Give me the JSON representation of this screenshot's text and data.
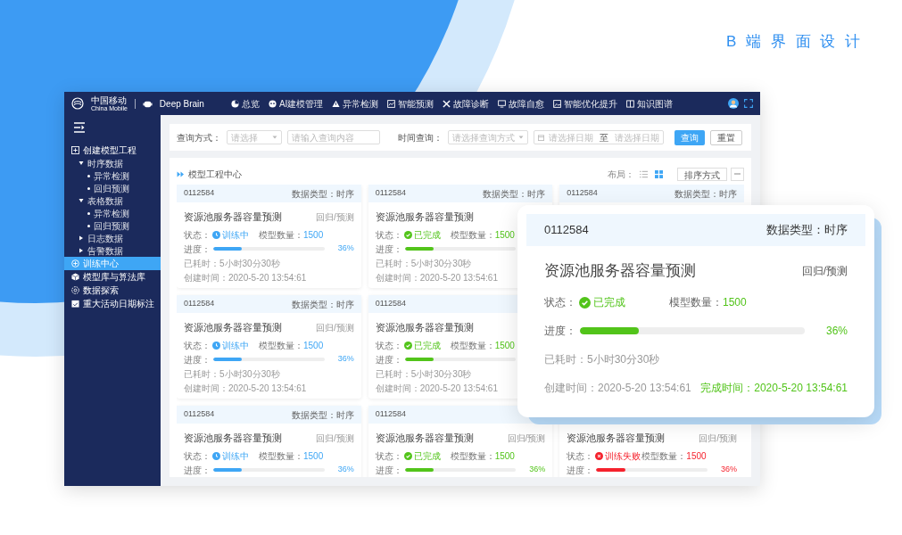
{
  "heading": "B 端 界 面 设 计",
  "header": {
    "brand": "中国移动",
    "brand_sub": "China Mobile",
    "product": "Deep Brain",
    "nav": [
      "总览",
      "AI建模管理",
      "异常检测",
      "智能预测",
      "故障诊断",
      "故障自愈",
      "智能优化提升",
      "知识图谱"
    ]
  },
  "sidebar": {
    "items": [
      {
        "label": "创建模型工程",
        "selected": false,
        "children": [
          {
            "label": "时序数据",
            "selected": false,
            "expanded": true,
            "children": [
              {
                "label": "异常检测",
                "selected": false
              },
              {
                "label": "回归预测",
                "selected": false
              }
            ]
          },
          {
            "label": "表格数据",
            "selected": false,
            "expanded": true,
            "children": [
              {
                "label": "异常检测",
                "selected": false
              },
              {
                "label": "回归预测",
                "selected": false
              }
            ]
          },
          {
            "label": "日志数据",
            "selected": false,
            "expanded": false
          },
          {
            "label": "告警数据",
            "selected": false,
            "expanded": false
          }
        ]
      },
      {
        "label": "训练中心",
        "selected": true
      },
      {
        "label": "模型库与算法库",
        "selected": false
      },
      {
        "label": "数据探索",
        "selected": false
      },
      {
        "label": "重大活动日期标注",
        "selected": false
      }
    ]
  },
  "filters": {
    "query_label": "查询方式：",
    "query_select": {
      "placeholder": "请选择"
    },
    "query_input": {
      "placeholder": "请输入查询内容"
    },
    "time_label": "时间查询：",
    "time_select": {
      "placeholder": "请选择查询方式"
    },
    "date_start": {
      "placeholder": "请选择日期"
    },
    "date_separator": "至",
    "date_end": {
      "placeholder": "请选择日期"
    },
    "buttons": [
      {
        "label": "查询",
        "kind": "primary"
      },
      {
        "label": "重置",
        "kind": "default"
      }
    ]
  },
  "list": {
    "title": "模型工程中心",
    "layout_label": "布局：",
    "layouts": [
      {
        "selected": false
      },
      {
        "selected": true
      }
    ],
    "sort_button": "排序方式",
    "rows": [
      [
        {
          "id": "0112584",
          "data_type": "数据类型：时序",
          "title": "资源池服务器容量预测",
          "task_type": "回归/预测",
          "status_label": "状态：",
          "kind": "training",
          "status_text": "训练中",
          "count_label": "模型数量：",
          "count": "1500",
          "progress_label": "进度：",
          "level": 0.26,
          "percent": "36%",
          "elapsed": "已耗时：5小时30分30秒",
          "created": "创建时间：2020-5-20 13:54:61"
        },
        {
          "id": "0112584",
          "data_type": "数据类型：时序",
          "title": "资源池服务器容量预测",
          "status_label": "状态：",
          "kind": "done",
          "status_text": "已完成",
          "count_label": "模型数量：",
          "count": "1500",
          "progress_label": "进度：",
          "level": 0.26,
          "elapsed": "已耗时：5小时30分30秒",
          "created": "创建时间：2020-5-20 13:54:61"
        },
        {
          "id": "0112584",
          "data_type": "数据类型：时序"
        }
      ],
      [
        {
          "id": "0112584",
          "data_type": "数据类型：时序",
          "title": "资源池服务器容量预测",
          "task_type": "回归/预测",
          "status_label": "状态：",
          "kind": "training",
          "status_text": "训练中",
          "count_label": "模型数量：",
          "count": "1500",
          "progress_label": "进度：",
          "level": 0.26,
          "percent": "36%",
          "elapsed": "已耗时：5小时30分30秒",
          "created": "创建时间：2020-5-20 13:54:61"
        },
        {
          "id": "0112584",
          "title": "资源池服务器容量预测",
          "status_label": "状态：",
          "kind": "done",
          "status_text": "已完成",
          "count_label": "模型数量：",
          "count": "1500",
          "progress_label": "进度：",
          "level": 0.26,
          "elapsed": "已耗时：5小时30分30秒",
          "created": "创建时间：2020-5-20 13:54:61"
        }
      ],
      [
        {
          "id": "0112584",
          "data_type": "数据类型：时序",
          "title": "资源池服务器容量预测",
          "task_type": "回归/预测",
          "status_label": "状态：",
          "kind": "training",
          "status_text": "训练中",
          "count_label": "模型数量：",
          "count": "1500",
          "progress_label": "进度：",
          "level": 0.26,
          "percent": "36%"
        },
        {
          "id": "0112584",
          "title": "资源池服务器容量预测",
          "task_type": "回归/预测",
          "status_label": "状态：",
          "kind": "done",
          "status_text": "已完成",
          "count_label": "模型数量：",
          "count": "1500",
          "progress_label": "进度：",
          "level": 0.26,
          "percent": "36%"
        },
        {
          "title": "资源池服务器容量预测",
          "task_type": "回归/预测",
          "status_label": "状态：",
          "kind": "failed",
          "status_text": "训练失败",
          "count_label": "模型数量：",
          "count": "1500",
          "progress_label": "进度：",
          "level": 0.26,
          "percent": "36%"
        }
      ]
    ]
  },
  "detail_card": {
    "id": "0112584",
    "data_type": "数据类型：时序",
    "title": "资源池服务器容量预测",
    "task_type": "回归/预测",
    "status_label": "状态：",
    "kind": "done",
    "status_text": "已完成",
    "count_label": "模型数量：",
    "count": "1500",
    "progress_label": "进度：",
    "level": 0.26,
    "percent": "36%",
    "elapsed": "已耗时：5小时30分30秒",
    "created": "创建时间：2020-5-20 13:54:61",
    "completed": "完成时间：2020-5-20 13:54:61"
  }
}
